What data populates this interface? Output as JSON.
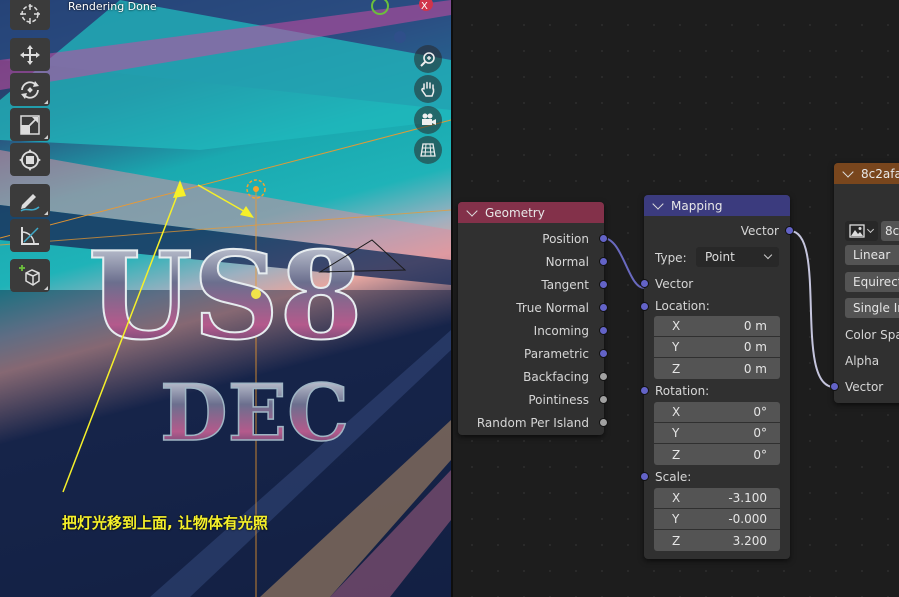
{
  "viewport": {
    "status_text": "Rendering Done",
    "caption": "把灯光移到上面, 让物体有光照",
    "art_title_line1": "US8",
    "art_title_line2": "DEC",
    "tools": [
      "cursor-tool",
      "move-tool",
      "rotate-tool",
      "scale-tool",
      "transform-tool",
      "annotate-tool",
      "measure-tool",
      "add-cube-tool"
    ],
    "nav": [
      "zoom-icon",
      "hand-icon",
      "camera-icon",
      "grid-icon"
    ]
  },
  "geometry_node": {
    "title": "Geometry",
    "outputs": [
      "Position",
      "Normal",
      "Tangent",
      "True Normal",
      "Incoming",
      "Parametric",
      "Backfacing",
      "Pointiness",
      "Random Per Island"
    ]
  },
  "mapping_node": {
    "title": "Mapping",
    "output": "Vector",
    "type_label": "Type:",
    "type_value": "Point",
    "vector_input": "Vector",
    "location_label": "Location:",
    "location": [
      [
        "X",
        "0 m"
      ],
      [
        "Y",
        "0 m"
      ],
      [
        "Z",
        "0 m"
      ]
    ],
    "rotation_label": "Rotation:",
    "rotation": [
      [
        "X",
        "0°"
      ],
      [
        "Y",
        "0°"
      ],
      [
        "Z",
        "0°"
      ]
    ],
    "scale_label": "Scale:",
    "scale": [
      [
        "X",
        "-3.100"
      ],
      [
        "Y",
        "-0.000"
      ],
      [
        "Z",
        "3.200"
      ]
    ]
  },
  "image_node": {
    "title": "8c2afa",
    "image_name": "8c",
    "interpolation": "Linear",
    "projection": "Equirect",
    "extension": "Single Ir",
    "color_space": "Color Spa",
    "alpha": "Alpha",
    "vector": "Vector"
  },
  "colors": {
    "geometry_header": "#83314a",
    "mapping_header": "#3b3b7e",
    "image_header": "#79461d",
    "vector_socket": "#6363c7",
    "float_socket": "#a1a1a1",
    "caption": "#f5f02a"
  }
}
